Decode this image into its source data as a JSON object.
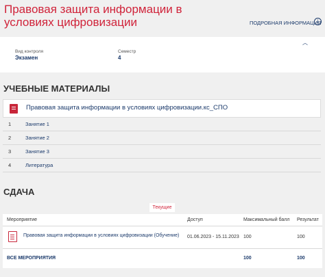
{
  "course": {
    "title": "Правовая защита информации в условиях цифровизации",
    "details_link": "ПОДРОБНАЯ ИНФОРМАЦИЯ",
    "details_icon": "info-circle-icon"
  },
  "info": {
    "control_label": "Вид контроля",
    "control_value": "Экзамен",
    "semester_label": "Семестр",
    "semester_value": "4",
    "toggle_icon": "chevron-up-icon"
  },
  "materials": {
    "heading": "УЧЕБНЫЕ МАТЕРИАЛЫ",
    "file": {
      "icon": "document-icon",
      "name": "Правовая защита информации в условиях цифровизации.кс_СПО"
    },
    "topics": [
      {
        "num": "1",
        "label": "Занятие 1"
      },
      {
        "num": "2",
        "label": "Занятие 2"
      },
      {
        "num": "3",
        "label": "Занятие 3"
      },
      {
        "num": "4",
        "label": "Литература"
      }
    ]
  },
  "submission": {
    "heading": "СДАЧА",
    "tab_current": "Текущие",
    "columns": {
      "event": "Мероприятие",
      "access": "Доступ",
      "max_score": "Максимальный балл",
      "result": "Результат"
    },
    "rows": [
      {
        "icon": "task-list-icon",
        "event": "Правовая защита информации в условиях цифровизации (Обучение)",
        "access": "01.06.2023 - 15.11.2023",
        "max_score": "100",
        "result": "100"
      }
    ],
    "total": {
      "label": "ВСЕ МЕРОПРИЯТИЯ",
      "max_score": "100",
      "result": "100"
    }
  },
  "colors": {
    "accent_red": "#d0233a",
    "link_blue": "#1b3a6b",
    "background": "#f0f0f0"
  }
}
